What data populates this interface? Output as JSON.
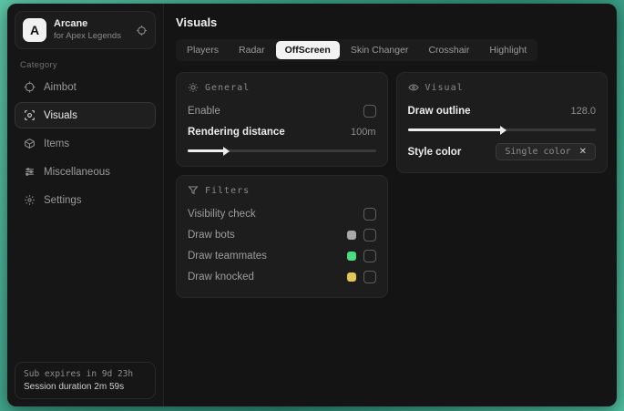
{
  "sidebar": {
    "logo_letter": "A",
    "app_name": "Arcane",
    "app_subtitle": "for Apex Legends",
    "category_label": "Category",
    "items": [
      {
        "label": "Aimbot",
        "icon": "crosshair-icon",
        "active": false
      },
      {
        "label": "Visuals",
        "icon": "scan-eye-icon",
        "active": true
      },
      {
        "label": "Items",
        "icon": "package-icon",
        "active": false
      },
      {
        "label": "Miscellaneous",
        "icon": "sliders-icon",
        "active": false
      },
      {
        "label": "Settings",
        "icon": "gear-icon",
        "active": false
      }
    ],
    "footer": {
      "expiry": "Sub expires in 9d 23h",
      "session": "Session duration 2m 59s"
    }
  },
  "main": {
    "title": "Visuals",
    "tabs": [
      {
        "label": "Players",
        "active": false
      },
      {
        "label": "Radar",
        "active": false
      },
      {
        "label": "OffScreen",
        "active": true
      },
      {
        "label": "Skin Changer",
        "active": false
      },
      {
        "label": "Crosshair",
        "active": false
      },
      {
        "label": "Highlight",
        "active": false
      }
    ],
    "panels": {
      "general": {
        "title": "General",
        "icon": "sun-gear-icon",
        "enable_label": "Enable",
        "enable_checked": false,
        "distance_label": "Rendering distance",
        "distance_value": "100m",
        "distance_percent": "20%"
      },
      "visual": {
        "title": "Visual",
        "icon": "eye-icon",
        "outline_label": "Draw outline",
        "outline_value": "128.0",
        "outline_percent": "50%",
        "style_label": "Style color",
        "style_value": "Single color",
        "style_clear": "✕"
      },
      "filters": {
        "title": "Filters",
        "icon": "funnel-icon",
        "rows": [
          {
            "label": "Visibility check",
            "swatch": null,
            "checked": false
          },
          {
            "label": "Draw bots",
            "swatch": "#a8a8a8",
            "checked": false
          },
          {
            "label": "Draw teammates",
            "swatch": "#4ade80",
            "checked": false
          },
          {
            "label": "Draw knocked",
            "swatch": "#e3c558",
            "checked": false
          }
        ]
      }
    }
  },
  "colors": {
    "desktop_teal": "#49b397",
    "window_bg": "#141414",
    "panel_bg": "#1d1d1d",
    "active_tab_bg": "#f2f2f2",
    "swatch_bots": "#a8a8a8",
    "swatch_teammates": "#4ade80",
    "swatch_knocked": "#e3c558"
  }
}
